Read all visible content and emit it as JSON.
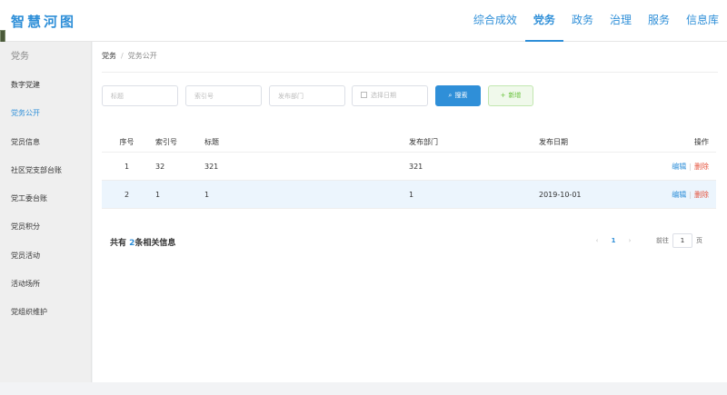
{
  "header": {
    "logo": "智慧河图",
    "nav": [
      "综合成效",
      "党务",
      "政务",
      "治理",
      "服务",
      "信息库"
    ],
    "active_nav": "党务"
  },
  "sidebar": {
    "title": "党务",
    "items": [
      {
        "label": "数字党建"
      },
      {
        "label": "党务公开"
      },
      {
        "label": "党员信息"
      },
      {
        "label": "社区党支部台账"
      },
      {
        "label": "党工委台账"
      },
      {
        "label": "党员积分"
      },
      {
        "label": "党员活动"
      },
      {
        "label": "活动场所"
      },
      {
        "label": "党组织维护"
      }
    ],
    "active_item": "党务公开"
  },
  "breadcrumb": {
    "items": [
      "党务",
      "党务公开"
    ],
    "separator": "/"
  },
  "filters": {
    "title_placeholder": "标题",
    "index_placeholder": "索引号",
    "dept_placeholder": "发布部门",
    "date_placeholder": "选择日期",
    "search_label": "搜索",
    "search_icon": "search-icon",
    "add_label": "新增",
    "add_icon": "plus-icon"
  },
  "table": {
    "headers": [
      "序号",
      "索引号",
      "标题",
      "发布部门",
      "发布日期",
      "操作"
    ],
    "rows": [
      {
        "seq": "1",
        "index_no": "32",
        "title": "321",
        "dept": "321",
        "date": "",
        "edit": "编辑",
        "delete": "删除"
      },
      {
        "seq": "2",
        "index_no": "1",
        "title": "1",
        "dept": "1",
        "date": "2019-10-01",
        "edit": "编辑",
        "delete": "删除"
      }
    ],
    "op_separator": "|"
  },
  "footer": {
    "prefix": "共有 ",
    "count": "2",
    "suffix": "条相关信息"
  },
  "pagination": {
    "prev": "‹",
    "page": "1",
    "next": "›",
    "goto_label": "前往",
    "goto_value": "1",
    "page_unit": "页"
  },
  "colors": {
    "accent": "#2f8fd8",
    "success": "#67c23a",
    "danger": "#e5533d",
    "row_highlight": "#ecf5fd"
  }
}
